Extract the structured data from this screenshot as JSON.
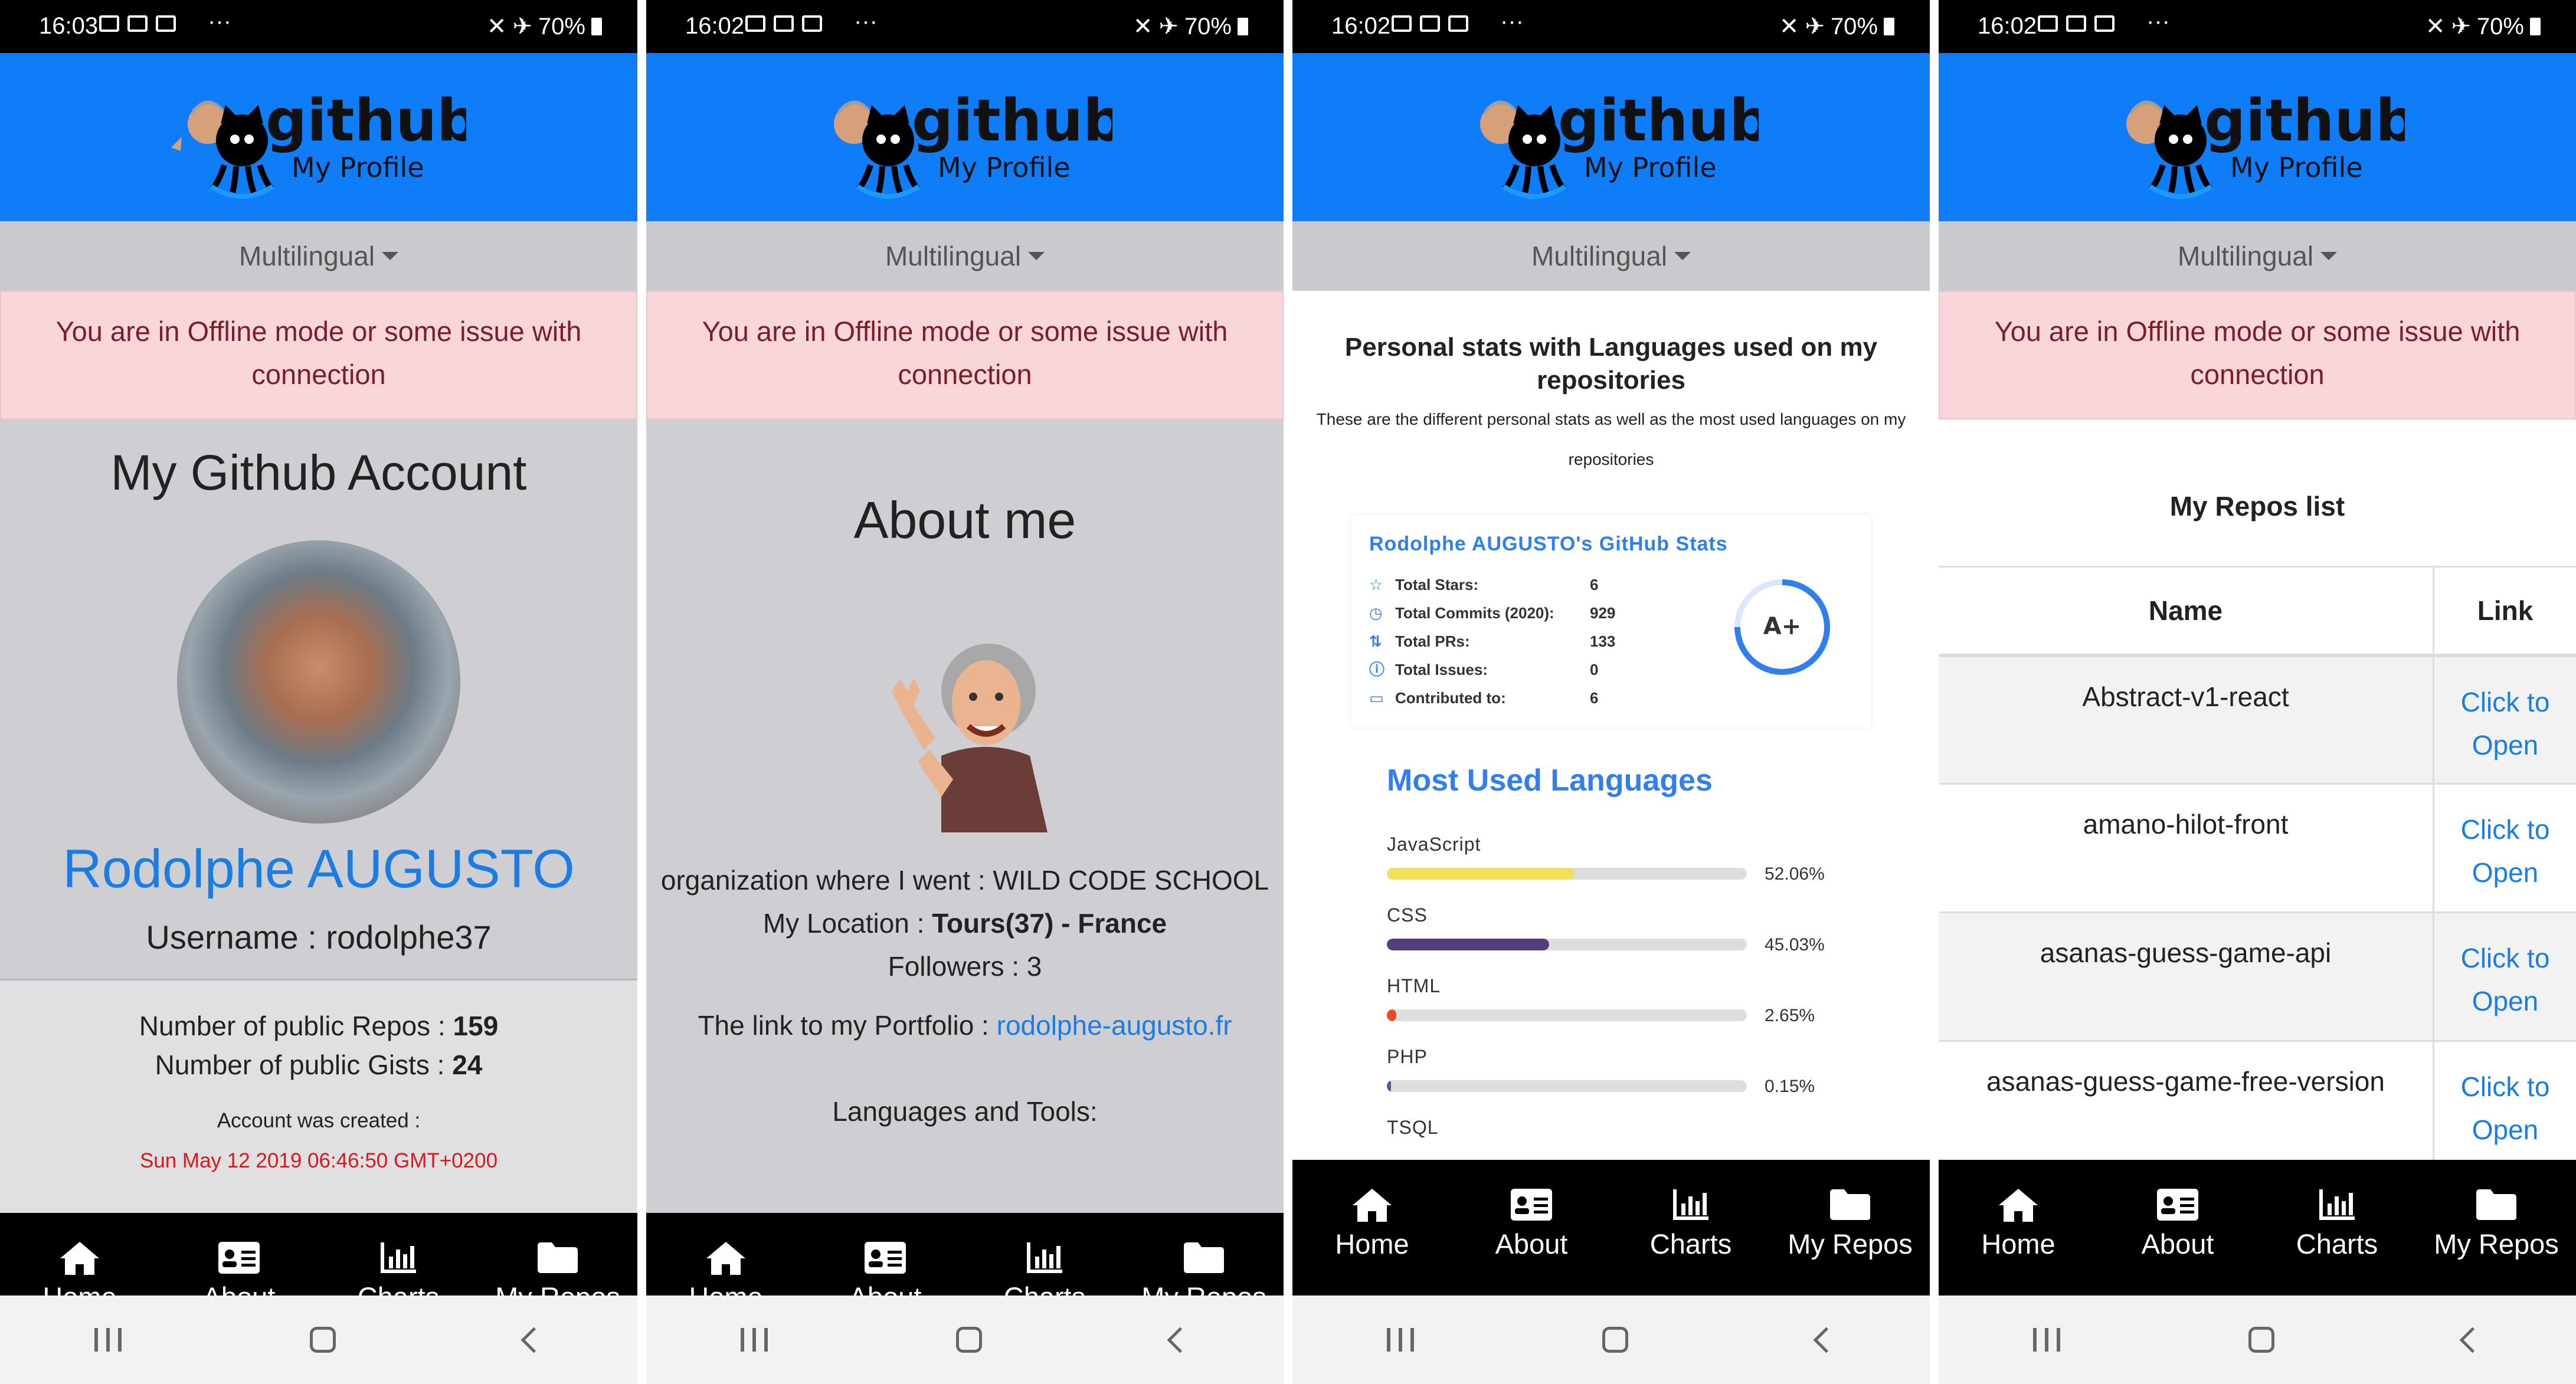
{
  "status": {
    "p1_time": "16:03",
    "p2_time": "16:02",
    "p3_time": "16:02",
    "p4_time": "16:02",
    "more": "···",
    "battery": "70%"
  },
  "logo": {
    "title": "github",
    "subtitle": "My Profile"
  },
  "lang_selector": "Multilingual",
  "alert": "You are in Offline mode or some issue with connection",
  "nav": [
    {
      "label": "Home",
      "icon": "home-icon"
    },
    {
      "label": "About",
      "icon": "id-card-icon"
    },
    {
      "label": "Charts",
      "icon": "bar-chart-icon"
    },
    {
      "label": "My Repos",
      "icon": "folder-icon"
    }
  ],
  "home": {
    "title": "My Github Account",
    "name": "Rodolphe AUGUSTO",
    "username_label": "Username : ",
    "username": "rodolphe37",
    "repos_label": "Number of public Repos : ",
    "repos": "159",
    "gists_label": "Number of public Gists : ",
    "gists": "24",
    "created_label": "Account was created :",
    "created_value": "Sun May 12 2019 06:46:50 GMT+0200"
  },
  "about": {
    "title": "About me",
    "org_label": "organization where I went : ",
    "org": "WILD CODE SCHOOL",
    "location_label": "My Location : ",
    "location": "Tours(37) - France",
    "followers": "Followers : 3",
    "portfolio_label": "The link to my Portfolio : ",
    "portfolio": "rodolphe-augusto.fr",
    "languages_tools": "Languages and Tools:"
  },
  "charts": {
    "title": "Personal stats with Languages used on my repositories",
    "desc_line1": "These are the different personal stats as well as the most used languages on my",
    "desc_line2": "repositories",
    "stats_title": "Rodolphe AUGUSTO's GitHub Stats",
    "stats": [
      {
        "label": "Total Stars:",
        "value": "6",
        "icon": "star-icon"
      },
      {
        "label": "Total Commits (2020):",
        "value": "929",
        "icon": "history-icon"
      },
      {
        "label": "Total PRs:",
        "value": "133",
        "icon": "pull-request-icon"
      },
      {
        "label": "Total Issues:",
        "value": "0",
        "icon": "issue-icon"
      },
      {
        "label": "Contributed to:",
        "value": "6",
        "icon": "repo-icon"
      }
    ],
    "grade": "A+",
    "grade_ring_fraction": 0.75,
    "lang_title": "Most Used Languages",
    "languages": [
      {
        "name": "JavaScript",
        "pct": "52.06%",
        "value": 52.06,
        "color": "#f1e05a"
      },
      {
        "name": "CSS",
        "pct": "45.03%",
        "value": 45.03,
        "color": "#563d7c"
      },
      {
        "name": "HTML",
        "pct": "2.65%",
        "value": 2.65,
        "color": "#e34c26"
      },
      {
        "name": "PHP",
        "pct": "0.15%",
        "value": 0.15,
        "color": "#4f5d95"
      },
      {
        "name": "TSQL",
        "pct": "",
        "value": 0,
        "color": "#e38c00"
      }
    ],
    "accent": "#2f80ed"
  },
  "repos": {
    "title": "My Repos list",
    "col_name": "Name",
    "col_link": "Link",
    "link_text_1": "Click to",
    "link_text_2": "Open",
    "rows": [
      "Abstract-v1-react",
      "amano-hilot-front",
      "asanas-guess-game-api",
      "asanas-guess-game-free-version"
    ]
  }
}
